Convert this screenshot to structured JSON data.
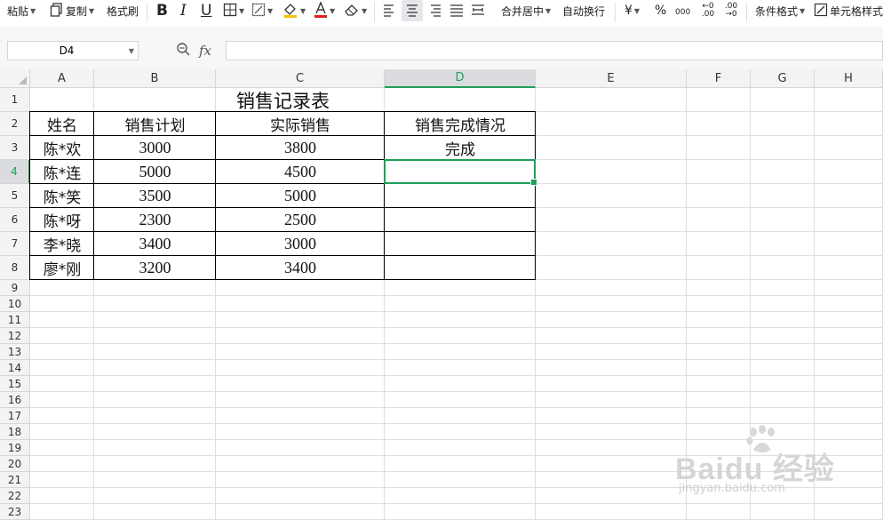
{
  "toolbar": {
    "paste": "粘贴",
    "copy": "复制",
    "format_painter": "格式刷",
    "bold": "B",
    "italic": "I",
    "underline": "U",
    "merge_center": "合并居中",
    "wrap_text": "自动换行",
    "currency": "¥",
    "percent": "%",
    "thousands": "000",
    "increase_decimal": "←0 .00",
    "decrease_decimal": ".00 →0",
    "conditional_format": "条件格式",
    "cell_style": "单元格样式"
  },
  "formula_bar": {
    "name_box": "D4",
    "fx_label": "fx",
    "formula": ""
  },
  "columns": [
    "A",
    "B",
    "C",
    "D",
    "E",
    "F",
    "G",
    "H"
  ],
  "active_column": "D",
  "rows": [
    "1",
    "2",
    "3",
    "4",
    "5",
    "6",
    "7",
    "8",
    "9",
    "10",
    "11",
    "12",
    "13",
    "14",
    "15",
    "16",
    "17",
    "18",
    "19",
    "20",
    "21",
    "22",
    "23"
  ],
  "active_row": "4",
  "sheet": {
    "title": "销售记录表",
    "headers": [
      "姓名",
      "销售计划",
      "实际销售",
      "销售完成情况"
    ],
    "records": [
      {
        "name": "陈*欢",
        "plan": "3000",
        "actual": "3800",
        "status": "完成"
      },
      {
        "name": "陈*连",
        "plan": "5000",
        "actual": "4500",
        "status": ""
      },
      {
        "name": "陈*笑",
        "plan": "3500",
        "actual": "5000",
        "status": ""
      },
      {
        "name": "陈*呀",
        "plan": "2300",
        "actual": "2500",
        "status": ""
      },
      {
        "name": "李*晓",
        "plan": "3400",
        "actual": "3000",
        "status": ""
      },
      {
        "name": "廖*刚",
        "plan": "3200",
        "actual": "3400",
        "status": ""
      }
    ]
  },
  "watermark": {
    "brand": "Baidu 经验",
    "site": "jingyan.baidu.com"
  },
  "colors": {
    "accent": "#1e9e5a",
    "header_bg": "#f3f3f3",
    "gridline": "#dcdfe3"
  }
}
